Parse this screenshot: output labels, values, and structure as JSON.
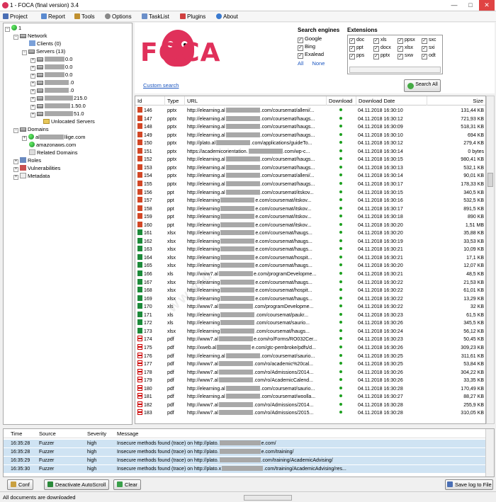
{
  "window": {
    "title": "1 - FOCA (final version) 3.4",
    "min": "—",
    "max": "□",
    "close": "✕"
  },
  "menu": [
    {
      "label": "Project",
      "icon": "project-icon",
      "color": "#4a6fb5"
    },
    {
      "label": "Report",
      "icon": "report-icon",
      "color": "#5a8ad0"
    },
    {
      "label": "Tools",
      "icon": "tools-icon",
      "color": "#c09030"
    },
    {
      "label": "Options",
      "icon": "options-icon",
      "color": "#888888"
    },
    {
      "label": "TaskList",
      "icon": "tasklist-icon",
      "color": "#6b8fc9"
    },
    {
      "label": "Plugins",
      "icon": "plugins-icon",
      "color": "#d04040"
    },
    {
      "label": "About",
      "icon": "about-icon",
      "color": "#3a7ad0"
    }
  ],
  "tree": {
    "root": "1",
    "network": "Network",
    "clients": "Clients (0)",
    "servers": "Servers (13)",
    "server_ips": [
      "0.0",
      "0.0",
      "0.0",
      ".0",
      ".0",
      "215.0",
      "1.50.0",
      "51.0"
    ],
    "unlocated": "Unlocated Servers",
    "domains": "Domains",
    "domain1_visible": "al",
    "domain1_suffix": "llige.com",
    "domain2": "amazonaws.com",
    "related": "Related Domains",
    "roles": "Roles",
    "vulnerabilities": "Vulnerabilities",
    "metadata": "Metadata"
  },
  "search": {
    "engines_header": "Search engines",
    "engines": [
      "Google",
      "Bing",
      "Exalead"
    ],
    "all": "All",
    "none": "None",
    "ext_header": "Extensions",
    "extensions": [
      "doc",
      "xls",
      "ppsx",
      "sxc",
      "ppt",
      "docx",
      "xlsx",
      "sxi",
      "pps",
      "pptx",
      "sxw",
      "odt"
    ],
    "custom_search": "Custom search",
    "search_all": "Search All"
  },
  "grid": {
    "headers": [
      "Id",
      "Type",
      "URL",
      "Download",
      "Download Date",
      "Size"
    ],
    "rows": [
      {
        "id": "146",
        "type": "pptx",
        "url": "http://elearning.al",
        "url_tail": ".com/coursemat/alleni/...",
        "date": "04.11.2018 16:30:10",
        "size": "131,44 KB"
      },
      {
        "id": "147",
        "type": "pptx",
        "url": "http://elearning.al",
        "url_tail": ".com/coursemat/haugs...",
        "date": "04.11.2018 16:30:12",
        "size": "721,93 KB"
      },
      {
        "id": "148",
        "type": "pptx",
        "url": "http://elearning.al",
        "url_tail": ".com/coursemat/haugs...",
        "date": "04.11.2018 16:30:09",
        "size": "518,31 KB"
      },
      {
        "id": "149",
        "type": "pptx",
        "url": "http://elearning.al",
        "url_tail": ".com/coursemat/haugs...",
        "date": "04.11.2018 16:30:10",
        "size": "694 KB"
      },
      {
        "id": "150",
        "type": "pptx",
        "url": "http://plato.al",
        "url_tail": ".com/applications/guideTo...",
        "date": "04.11.2018 16:30:12",
        "size": "279,4 KB"
      },
      {
        "id": "151",
        "type": "pptx",
        "url": "https://academicorientation.",
        "url_tail": ".com/wp-c...",
        "date": "04.11.2018 16:30:14",
        "size": "0 bytes"
      },
      {
        "id": "152",
        "type": "pptx",
        "url": "http://elearning.al",
        "url_tail": ".com/coursemat/haugs...",
        "date": "04.11.2018 16:30:15",
        "size": "980,41 KB"
      },
      {
        "id": "153",
        "type": "pptx",
        "url": "http://elearning.al",
        "url_tail": ".com/coursemat/haugs...",
        "date": "04.11.2018 16:30:13",
        "size": "532,1 KB"
      },
      {
        "id": "154",
        "type": "pptx",
        "url": "http://elearning.al",
        "url_tail": ".com/coursemat/alleni/...",
        "date": "04.11.2018 16:30:14",
        "size": "90,01 KB"
      },
      {
        "id": "155",
        "type": "pptx",
        "url": "http://elearning.al",
        "url_tail": ".com/coursemat/haugs...",
        "date": "04.11.2018 16:30:17",
        "size": "178,33 KB"
      },
      {
        "id": "156",
        "type": "ppt",
        "url": "http://elearning.al",
        "url_tail": ".com/coursemat/itskov...",
        "date": "04.11.2018 16:30:15",
        "size": "340,5 KB"
      },
      {
        "id": "157",
        "type": "ppt",
        "url": "http://elearning",
        "url_tail": "e.com/coursemat/itskov...",
        "date": "04.11.2018 16:30:16",
        "size": "532,5 KB"
      },
      {
        "id": "158",
        "type": "ppt",
        "url": "http://elearning",
        "url_tail": "e.com/coursemat/itskov...",
        "date": "04.11.2018 16:30:17",
        "size": "891,5 KB"
      },
      {
        "id": "159",
        "type": "ppt",
        "url": "http://elearning",
        "url_tail": "e.com/coursemat/itskov...",
        "date": "04.11.2018 16:30:18",
        "size": "890 KB"
      },
      {
        "id": "160",
        "type": "ppt",
        "url": "http://elearning",
        "url_tail": "e.com/coursemat/itskov...",
        "date": "04.11.2018 16:30:20",
        "size": "1,51 MB"
      },
      {
        "id": "161",
        "type": "xlsx",
        "url": "http://elearning",
        "url_tail": "e.com/coursemat/haugs...",
        "date": "04.11.2018 16:30:20",
        "size": "35,88 KB"
      },
      {
        "id": "162",
        "type": "xlsx",
        "url": "http://elearning",
        "url_tail": "e.com/coursemat/haugs...",
        "date": "04.11.2018 16:30:19",
        "size": "33,53 KB"
      },
      {
        "id": "163",
        "type": "xlsx",
        "url": "http://elearning",
        "url_tail": "e.com/coursemat/haugs...",
        "date": "04.11.2018 16:30:21",
        "size": "10,09 KB"
      },
      {
        "id": "164",
        "type": "xlsx",
        "url": "http://elearning",
        "url_tail": "e.com/coursemat/hospit...",
        "date": "04.11.2018 16:30:21",
        "size": "17,1 KB"
      },
      {
        "id": "165",
        "type": "xlsx",
        "url": "http://elearning",
        "url_tail": "e.com/coursemat/haugs...",
        "date": "04.11.2018 16:30:20",
        "size": "12,07 KB"
      },
      {
        "id": "166",
        "type": "xls",
        "url": "http://www7.al",
        "url_tail": "e.com/programDevelopme...",
        "date": "04.11.2018 16:30:21",
        "size": "48,5 KB"
      },
      {
        "id": "167",
        "type": "xlsx",
        "url": "http://elearning",
        "url_tail": "e.com/coursemat/haugs...",
        "date": "04.11.2018 16:30:22",
        "size": "21,53 KB"
      },
      {
        "id": "168",
        "type": "xlsx",
        "url": "http://elearning",
        "url_tail": "e.com/coursemat/hospit...",
        "date": "04.11.2018 16:30:22",
        "size": "61,01 KB"
      },
      {
        "id": "169",
        "type": "xlsx",
        "url": "http://elearning",
        "url_tail": "e.com/coursemat/haugs...",
        "date": "04.11.2018 16:30:22",
        "size": "13,29 KB"
      },
      {
        "id": "170",
        "type": "xls",
        "url": "http://www7.al",
        "url_tail": ".com/programDevelopme...",
        "date": "04.11.2018 16:30:22",
        "size": "32 KB"
      },
      {
        "id": "171",
        "type": "xls",
        "url": "http://elearning",
        "url_tail": ".com/coursemat/paukr...",
        "date": "04.11.2018 16:30:23",
        "size": "61,5 KB"
      },
      {
        "id": "172",
        "type": "xls",
        "url": "http://elearning",
        "url_tail": ".com/coursemat/saurio...",
        "date": "04.11.2018 16:30:26",
        "size": "345,5 KB"
      },
      {
        "id": "173",
        "type": "xlsx",
        "url": "http://elearning",
        "url_tail": ".com/coursemat/haugs...",
        "date": "04.11.2018 16:30:24",
        "size": "56,12 KB"
      },
      {
        "id": "174",
        "type": "pdf",
        "url": "http://www7.al",
        "url_tail": "e.com/ro/Forms/RO032Cer...",
        "date": "04.11.2018 16:30:23",
        "size": "50,45 KB"
      },
      {
        "id": "175",
        "type": "pdf",
        "url": "http://xweb.al",
        "url_tail": "e.com/gtc-pembroke/pdfs/d...",
        "date": "04.11.2018 16:30:26",
        "size": "309,23 KB"
      },
      {
        "id": "176",
        "type": "pdf",
        "url": "http://elearning.al",
        "url_tail": ".com/coursemat/saurio...",
        "date": "04.11.2018 16:30:25",
        "size": "311,61 KB"
      },
      {
        "id": "177",
        "type": "pdf",
        "url": "http://www7.al",
        "url_tail": ".com/ro/academic%20cal...",
        "date": "04.11.2018 16:30:25",
        "size": "53,84 KB"
      },
      {
        "id": "178",
        "type": "pdf",
        "url": "http://www7.al",
        "url_tail": ".com/ro/Admissions/2014...",
        "date": "04.11.2018 16:30:26",
        "size": "304,22 KB"
      },
      {
        "id": "179",
        "type": "pdf",
        "url": "http://www7.al",
        "url_tail": ".com/ro/AcademicCalend...",
        "date": "04.11.2018 16:30:26",
        "size": "33,35 KB"
      },
      {
        "id": "180",
        "type": "pdf",
        "url": "http://elearning.al",
        "url_tail": ".com/coursemat/saurio...",
        "date": "04.11.2018 16:30:28",
        "size": "170,49 KB"
      },
      {
        "id": "181",
        "type": "pdf",
        "url": "http://elearning.al",
        "url_tail": ".com/coursemat/woolla...",
        "date": "04.11.2018 16:30:27",
        "size": "88,27 KB"
      },
      {
        "id": "182",
        "type": "pdf",
        "url": "http://www7.al",
        "url_tail": ".com/ro/Admissions/2014...",
        "date": "04.11.2018 16:30:28",
        "size": "255,9 KB"
      },
      {
        "id": "183",
        "type": "pdf",
        "url": "http://www7.al",
        "url_tail": ".com/ro/Admissions/2015...",
        "date": "04.11.2018 16:30:28",
        "size": "310,05 KB"
      }
    ]
  },
  "log": {
    "headers": [
      "Time",
      "Source",
      "Severity",
      "Message"
    ],
    "rows": [
      {
        "time": "16:35:28",
        "source": "Fuzzer",
        "severity": "high",
        "msg": "Insecure methods found (trace) on http://plato.",
        "tail": "e.com/"
      },
      {
        "time": "16:35:28",
        "source": "Fuzzer",
        "severity": "high",
        "msg": "Insecure methods found (trace) on http://plato.",
        "tail": "e.com/training/"
      },
      {
        "time": "16:35:29",
        "source": "Fuzzer",
        "severity": "high",
        "msg": "Insecure methods found (trace) on http://plato.",
        "tail": ".com/training/AcademicAdvising/"
      },
      {
        "time": "16:35:30",
        "source": "Fuzzer",
        "severity": "high",
        "msg": "Insecure methods found (trace) on http://plato.x",
        "tail": ".com/training/AcademicAdvising/res..."
      }
    ]
  },
  "buttons": {
    "conf": "Conf",
    "deactivate": "Deactivate AutoScroll",
    "clear": "Clear",
    "save_log": "Save log to File"
  },
  "status": {
    "text": "All documents are downloaded"
  },
  "logo_text": "FOCA",
  "colors": {
    "accent": "#e0305a",
    "log_row": "#cfe3f3",
    "link": "#1a55c0"
  }
}
